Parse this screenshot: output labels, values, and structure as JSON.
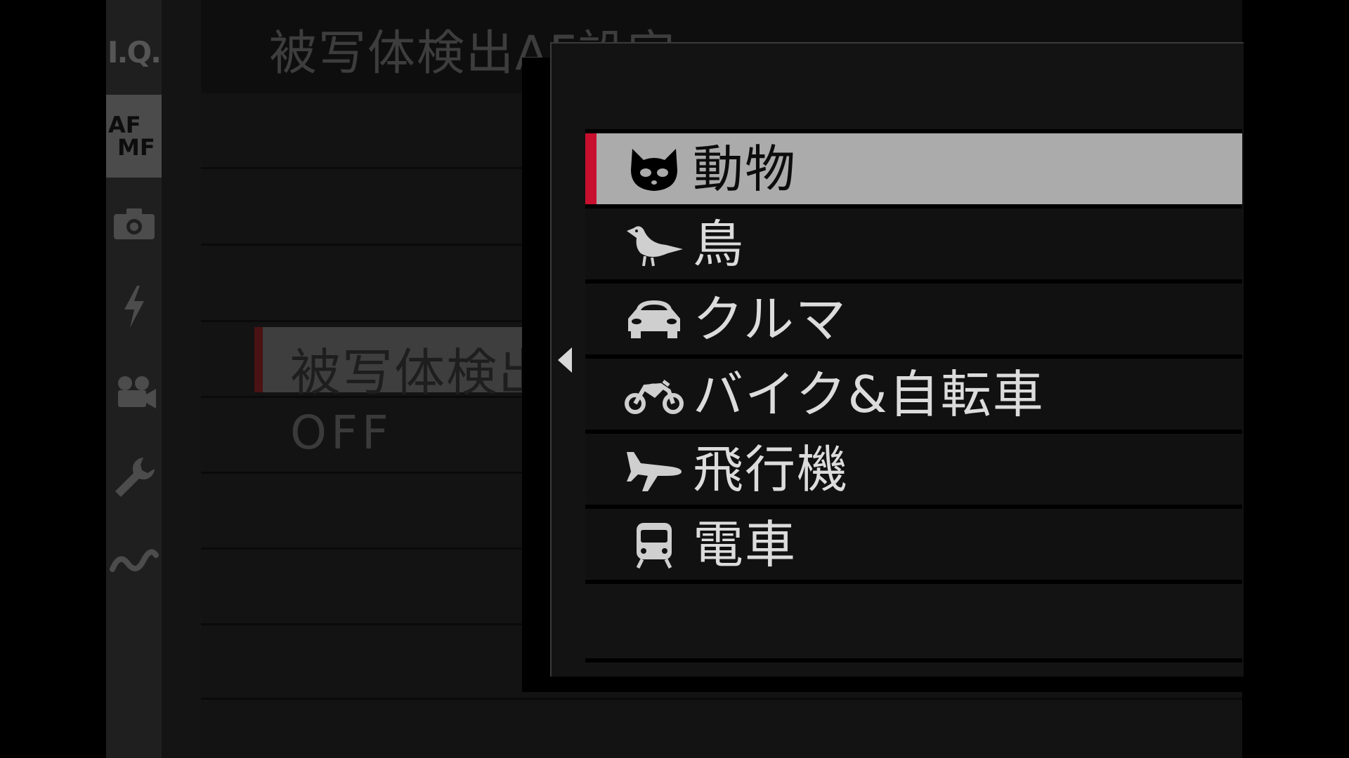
{
  "side_tabs": [
    {
      "id": "iq",
      "label": "I.Q."
    },
    {
      "id": "afmf",
      "label_top": "AF",
      "label_bottom": "MF",
      "active": true
    },
    {
      "id": "shooting",
      "icon": "camera-icon"
    },
    {
      "id": "flash",
      "icon": "flash-icon"
    },
    {
      "id": "movie",
      "icon": "movie-camera-icon"
    },
    {
      "id": "setup",
      "icon": "wrench-icon"
    },
    {
      "id": "connection",
      "icon": "connection-icon"
    }
  ],
  "menu": {
    "title": "被写体検出AF設定",
    "selected_row_label": "被写体検出",
    "off_label": "OFF"
  },
  "popup": {
    "items": [
      {
        "label": "動物",
        "icon": "cat-icon",
        "selected": true
      },
      {
        "label": "鳥",
        "icon": "bird-icon"
      },
      {
        "label": "クルマ",
        "icon": "car-icon"
      },
      {
        "label": "バイク&自転車",
        "icon": "motorcycle-icon"
      },
      {
        "label": "飛行機",
        "icon": "airplane-icon"
      },
      {
        "label": "電車",
        "icon": "train-icon"
      }
    ]
  },
  "colors": {
    "accent_red": "#c8102e",
    "selected_bg": "#ababab",
    "menu_bg": "#131313"
  }
}
